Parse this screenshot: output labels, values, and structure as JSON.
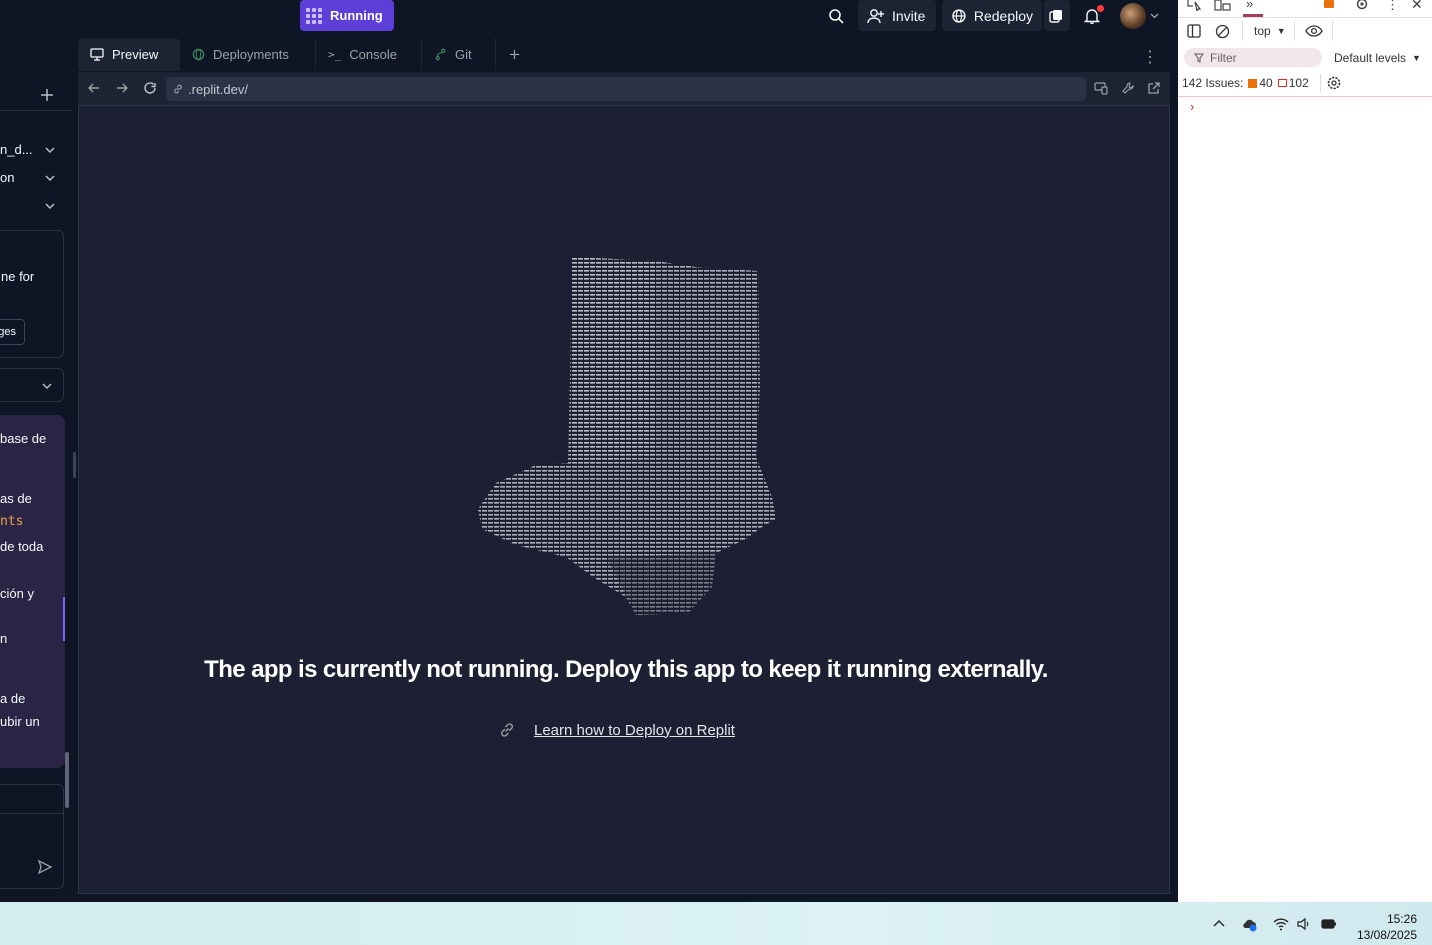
{
  "header": {
    "run_label": "Running",
    "invite_label": "Invite",
    "redeploy_label": "Redeploy"
  },
  "left_panel": {
    "rows": [
      "n_d...",
      "on",
      "ne for",
      "ges",
      "base de",
      "as de",
      "nts",
      "de toda",
      "ción y",
      "n",
      "a de",
      "ubir un"
    ]
  },
  "tabs": [
    {
      "label": "Preview"
    },
    {
      "label": "Deployments"
    },
    {
      "label": "Console"
    },
    {
      "label": "Git"
    }
  ],
  "url": ".replit.dev/",
  "preview": {
    "message": "The app is currently not running. Deploy this app to keep it running externally.",
    "link_label": "Learn how to Deploy on Replit"
  },
  "devtools": {
    "context": "top",
    "filter_placeholder": "Filter",
    "levels": "Default levels",
    "issues_label": "142 Issues:",
    "issues_warn": "40",
    "issues_info": "102",
    "warn_color": "#e8710a",
    "info_color": "#d93025"
  },
  "taskbar": {
    "time": "15:26",
    "date": "13/08/2025"
  },
  "colors": {
    "accent": "#5b3fd6",
    "bg": "#0e1525",
    "surface": "#1c2333"
  }
}
